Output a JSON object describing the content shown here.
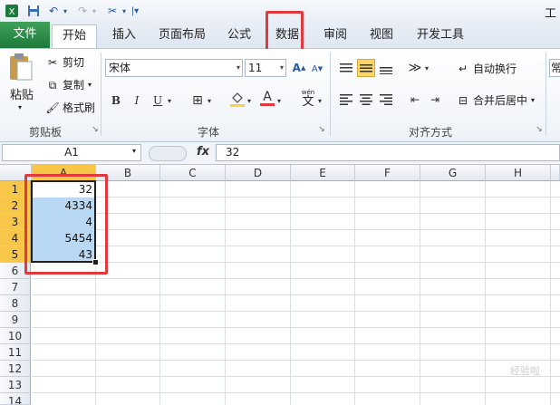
{
  "app_title": "工",
  "qat": {
    "save_icon": "save-icon",
    "undo_icon": "undo-icon",
    "redo_icon": "redo-icon",
    "customize_icon": "tools-icon"
  },
  "tabs": {
    "file": "文件",
    "home": "开始",
    "insert": "插入",
    "page_layout": "页面布局",
    "formulas": "公式",
    "data": "数据",
    "review": "审阅",
    "view": "视图",
    "developer": "开发工具"
  },
  "clipboard": {
    "paste": "粘贴",
    "cut": "剪切",
    "copy": "复制",
    "format_painter": "格式刷",
    "group_label": "剪贴板"
  },
  "font": {
    "name": "宋体",
    "size": "11",
    "bold": "B",
    "italic": "I",
    "underline": "U",
    "font_color_letter": "A",
    "phonetic_top": "wén",
    "phonetic_char": "文",
    "grow": "A",
    "shrink": "A",
    "group_label": "字体"
  },
  "alignment": {
    "wrap_text": "自动换行",
    "merge_center": "合并后居中",
    "group_label": "对齐方式"
  },
  "number": {
    "format_partial": "常"
  },
  "formula_bar": {
    "name_box": "A1",
    "fx": "fx",
    "value": "32"
  },
  "columns": [
    "A",
    "B",
    "C",
    "D",
    "E",
    "F",
    "G",
    "H"
  ],
  "rows": [
    "1",
    "2",
    "3",
    "4",
    "5",
    "6",
    "7",
    "8",
    "9",
    "10",
    "11",
    "12",
    "13",
    "14"
  ],
  "cells_A": [
    "32",
    "4334",
    "4",
    "5454",
    "43"
  ],
  "watermark": "经验啦",
  "colors": {
    "file_tab": "#1e7a3c",
    "highlight": "#e0393e",
    "selection_fill": "#b9d8f4",
    "header_selected": "#f8c74a"
  }
}
